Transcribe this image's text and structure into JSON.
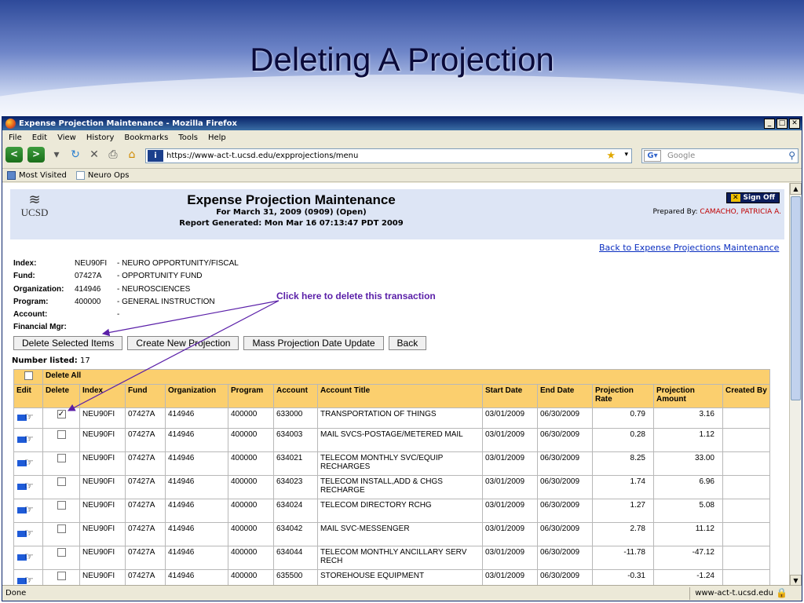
{
  "slide": {
    "title": "Deleting A Projection"
  },
  "browser": {
    "window_title": "Expense Projection Maintenance - Mozilla Firefox",
    "menu": [
      {
        "label": "File",
        "ul": "F",
        "rest": "ile"
      },
      {
        "label": "Edit",
        "ul": "E",
        "rest": "dit"
      },
      {
        "label": "View",
        "ul": "V",
        "rest": "iew"
      },
      {
        "label": "History",
        "ul": "s",
        "rest": ""
      },
      {
        "label": "Bookmarks",
        "ul": "B",
        "rest": "ookmarks"
      },
      {
        "label": "Tools",
        "ul": "T",
        "rest": "ools"
      },
      {
        "label": "Help",
        "ul": "H",
        "rest": "elp"
      }
    ],
    "url": "https://www-act-t.ucsd.edu/expprojections/menu",
    "search_placeholder": "Google",
    "bookmarks": [
      "Most Visited",
      "Neuro Ops"
    ],
    "status": "Done",
    "status_host": "www-act-t.ucsd.edu"
  },
  "app": {
    "logo_text": "UCSD",
    "title": "Expense Projection Maintenance",
    "subtitle1": "For March 31, 2009 (0909) (Open)",
    "subtitle2": "Report Generated: Mon Mar 16 07:13:47 PDT 2009",
    "signoff": "Sign Off",
    "prepared_label": "Prepared By:",
    "prepared_name": "CAMACHO, PATRICIA A.",
    "back_link": "Back to Expense Projections Maintenance"
  },
  "info": {
    "index": {
      "label": "Index:",
      "code": "NEU90FI",
      "desc": "- NEURO OPPORTUNITY/FISCAL"
    },
    "fund": {
      "label": "Fund:",
      "code": "07427A",
      "desc": "- OPPORTUNITY FUND"
    },
    "organization": {
      "label": "Organization:",
      "code": "414946",
      "desc": "- NEUROSCIENCES"
    },
    "program": {
      "label": "Program:",
      "code": "400000",
      "desc": "- GENERAL INSTRUCTION"
    },
    "account": {
      "label": "Account:",
      "code": "",
      "desc": "-"
    },
    "financial_mgr": {
      "label": "Financial Mgr:",
      "code": "",
      "desc": ""
    }
  },
  "callout": "Click here to delete this transaction",
  "buttons": {
    "delete_selected": "Delete Selected Items",
    "create_new": "Create New Projection",
    "mass_update": "Mass Projection Date Update",
    "back": "Back"
  },
  "number_listed_label": "Number listed:",
  "number_listed": "17",
  "delete_all": "Delete All",
  "columns": [
    "Edit",
    "Delete",
    "Index",
    "Fund",
    "Organization",
    "Program",
    "Account",
    "Account Title",
    "Start Date",
    "End Date",
    "Projection Rate",
    "Projection Amount",
    "Created By"
  ],
  "rows": [
    {
      "checked": true,
      "index": "NEU90FI",
      "fund": "07427A",
      "org": "414946",
      "program": "400000",
      "account": "633000",
      "title": "TRANSPORTATION OF THINGS",
      "start": "03/01/2009",
      "end": "06/30/2009",
      "rate": "0.79",
      "amount": "3.16",
      "created_by": ""
    },
    {
      "checked": false,
      "index": "NEU90FI",
      "fund": "07427A",
      "org": "414946",
      "program": "400000",
      "account": "634003",
      "title": "MAIL SVCS-POSTAGE/METERED MAIL",
      "start": "03/01/2009",
      "end": "06/30/2009",
      "rate": "0.28",
      "amount": "1.12",
      "created_by": ""
    },
    {
      "checked": false,
      "index": "NEU90FI",
      "fund": "07427A",
      "org": "414946",
      "program": "400000",
      "account": "634021",
      "title": "TELECOM MONTHLY SVC/EQUIP RECHARGES",
      "start": "03/01/2009",
      "end": "06/30/2009",
      "rate": "8.25",
      "amount": "33.00",
      "created_by": ""
    },
    {
      "checked": false,
      "index": "NEU90FI",
      "fund": "07427A",
      "org": "414946",
      "program": "400000",
      "account": "634023",
      "title": "TELECOM INSTALL,ADD & CHGS RECHARGE",
      "start": "03/01/2009",
      "end": "06/30/2009",
      "rate": "1.74",
      "amount": "6.96",
      "created_by": ""
    },
    {
      "checked": false,
      "index": "NEU90FI",
      "fund": "07427A",
      "org": "414946",
      "program": "400000",
      "account": "634024",
      "title": "TELECOM DIRECTORY RCHG",
      "start": "03/01/2009",
      "end": "06/30/2009",
      "rate": "1.27",
      "amount": "5.08",
      "created_by": ""
    },
    {
      "checked": false,
      "index": "NEU90FI",
      "fund": "07427A",
      "org": "414946",
      "program": "400000",
      "account": "634042",
      "title": "MAIL SVC-MESSENGER",
      "start": "03/01/2009",
      "end": "06/30/2009",
      "rate": "2.78",
      "amount": "11.12",
      "created_by": ""
    },
    {
      "checked": false,
      "index": "NEU90FI",
      "fund": "07427A",
      "org": "414946",
      "program": "400000",
      "account": "634044",
      "title": "TELECOM MONTHLY ANCILLARY SERV RECH",
      "start": "03/01/2009",
      "end": "06/30/2009",
      "rate": "-11.78",
      "amount": "-47.12",
      "created_by": ""
    },
    {
      "checked": false,
      "index": "NEU90FI",
      "fund": "07427A",
      "org": "414946",
      "program": "400000",
      "account": "635500",
      "title": "STOREHOUSE EQUIPMENT",
      "start": "03/01/2009",
      "end": "06/30/2009",
      "rate": "-0.31",
      "amount": "-1.24",
      "created_by": ""
    }
  ]
}
